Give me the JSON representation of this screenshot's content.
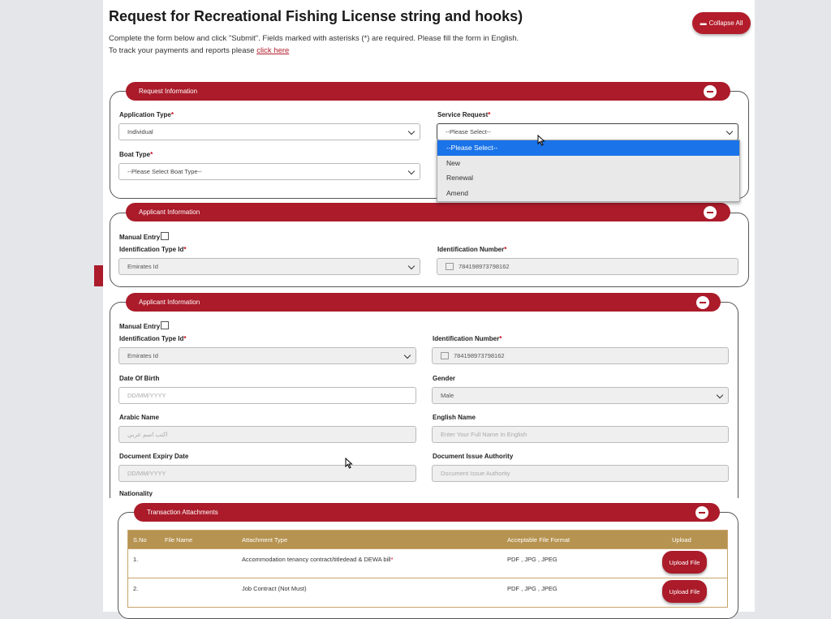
{
  "page": {
    "title": "Request for Recreational Fishing License string and hooks)",
    "desc_line1": "Complete the form below and click \"Submit\". Fields marked with asterisks (*) are required. Please fill the form in English.",
    "desc_line2_prefix": "To track your payments and reports please ",
    "desc_link": "click here",
    "collapse_all": "Collapse All"
  },
  "request_info": {
    "header": "Request Information",
    "application_type_label": "Application Type",
    "application_type_value": "Individual",
    "service_request_label": "Service Request",
    "service_request_value": "--Please Select--",
    "boat_type_label": "Boat Type",
    "boat_type_value": "--Please Select Boat Type--",
    "service_options": [
      "--Please Select--",
      "New",
      "Renewal",
      "Amend"
    ],
    "selected_option": "--Please Select--"
  },
  "applicant_bg": {
    "header": "Applicant Information",
    "manual_entry": "Manual Entry",
    "id_type_label": "Identification Type Id",
    "id_type_value": "Emirates Id",
    "id_number_label": "Identification Number",
    "id_number_value": "784198973798162"
  },
  "applicant": {
    "header": "Applicant Information",
    "manual_entry": "Manual Entry",
    "id_type_label": "Identification Type Id",
    "id_type_value": "Emirates Id",
    "id_number_label": "Identification Number",
    "id_number_value": "784198973798162",
    "dob_label": "Date Of Birth",
    "dob_placeholder": "DD/MM/YYYY",
    "gender_label": "Gender",
    "gender_value": "Male",
    "arabic_name_label": "Arabic Name",
    "arabic_name_placeholder": "اكتب اسم عربي",
    "english_name_label": "English Name",
    "english_name_placeholder": "Enter Your Full Name In English",
    "doc_expiry_label": "Document Expiry Date",
    "doc_expiry_placeholder": "DD/MM/YYYY",
    "doc_issue_label": "Document Issue Authority",
    "doc_issue_placeholder": "Document Issue Authority",
    "nationality_label": "Nationality"
  },
  "attachments": {
    "header": "Transaction Attachments",
    "columns": [
      "S.No",
      "File Name",
      "Attachment Type",
      "Acceptable File Format",
      "Upload"
    ],
    "rows": [
      {
        "sno": "1.",
        "type": "Accommodation tenancy contract/titledead & DEWA bill",
        "required": "*",
        "format": "PDF , JPG , JPEG",
        "button": "Upload File"
      },
      {
        "sno": "2.",
        "type": "Job Contract (Not Must)",
        "required": "",
        "format": "PDF , JPG , JPEG",
        "button": "Upload File"
      }
    ]
  },
  "colors": {
    "brand_red": "#ab1b2a",
    "table_gold": "#b69351",
    "select_blue": "#1a73e8"
  }
}
